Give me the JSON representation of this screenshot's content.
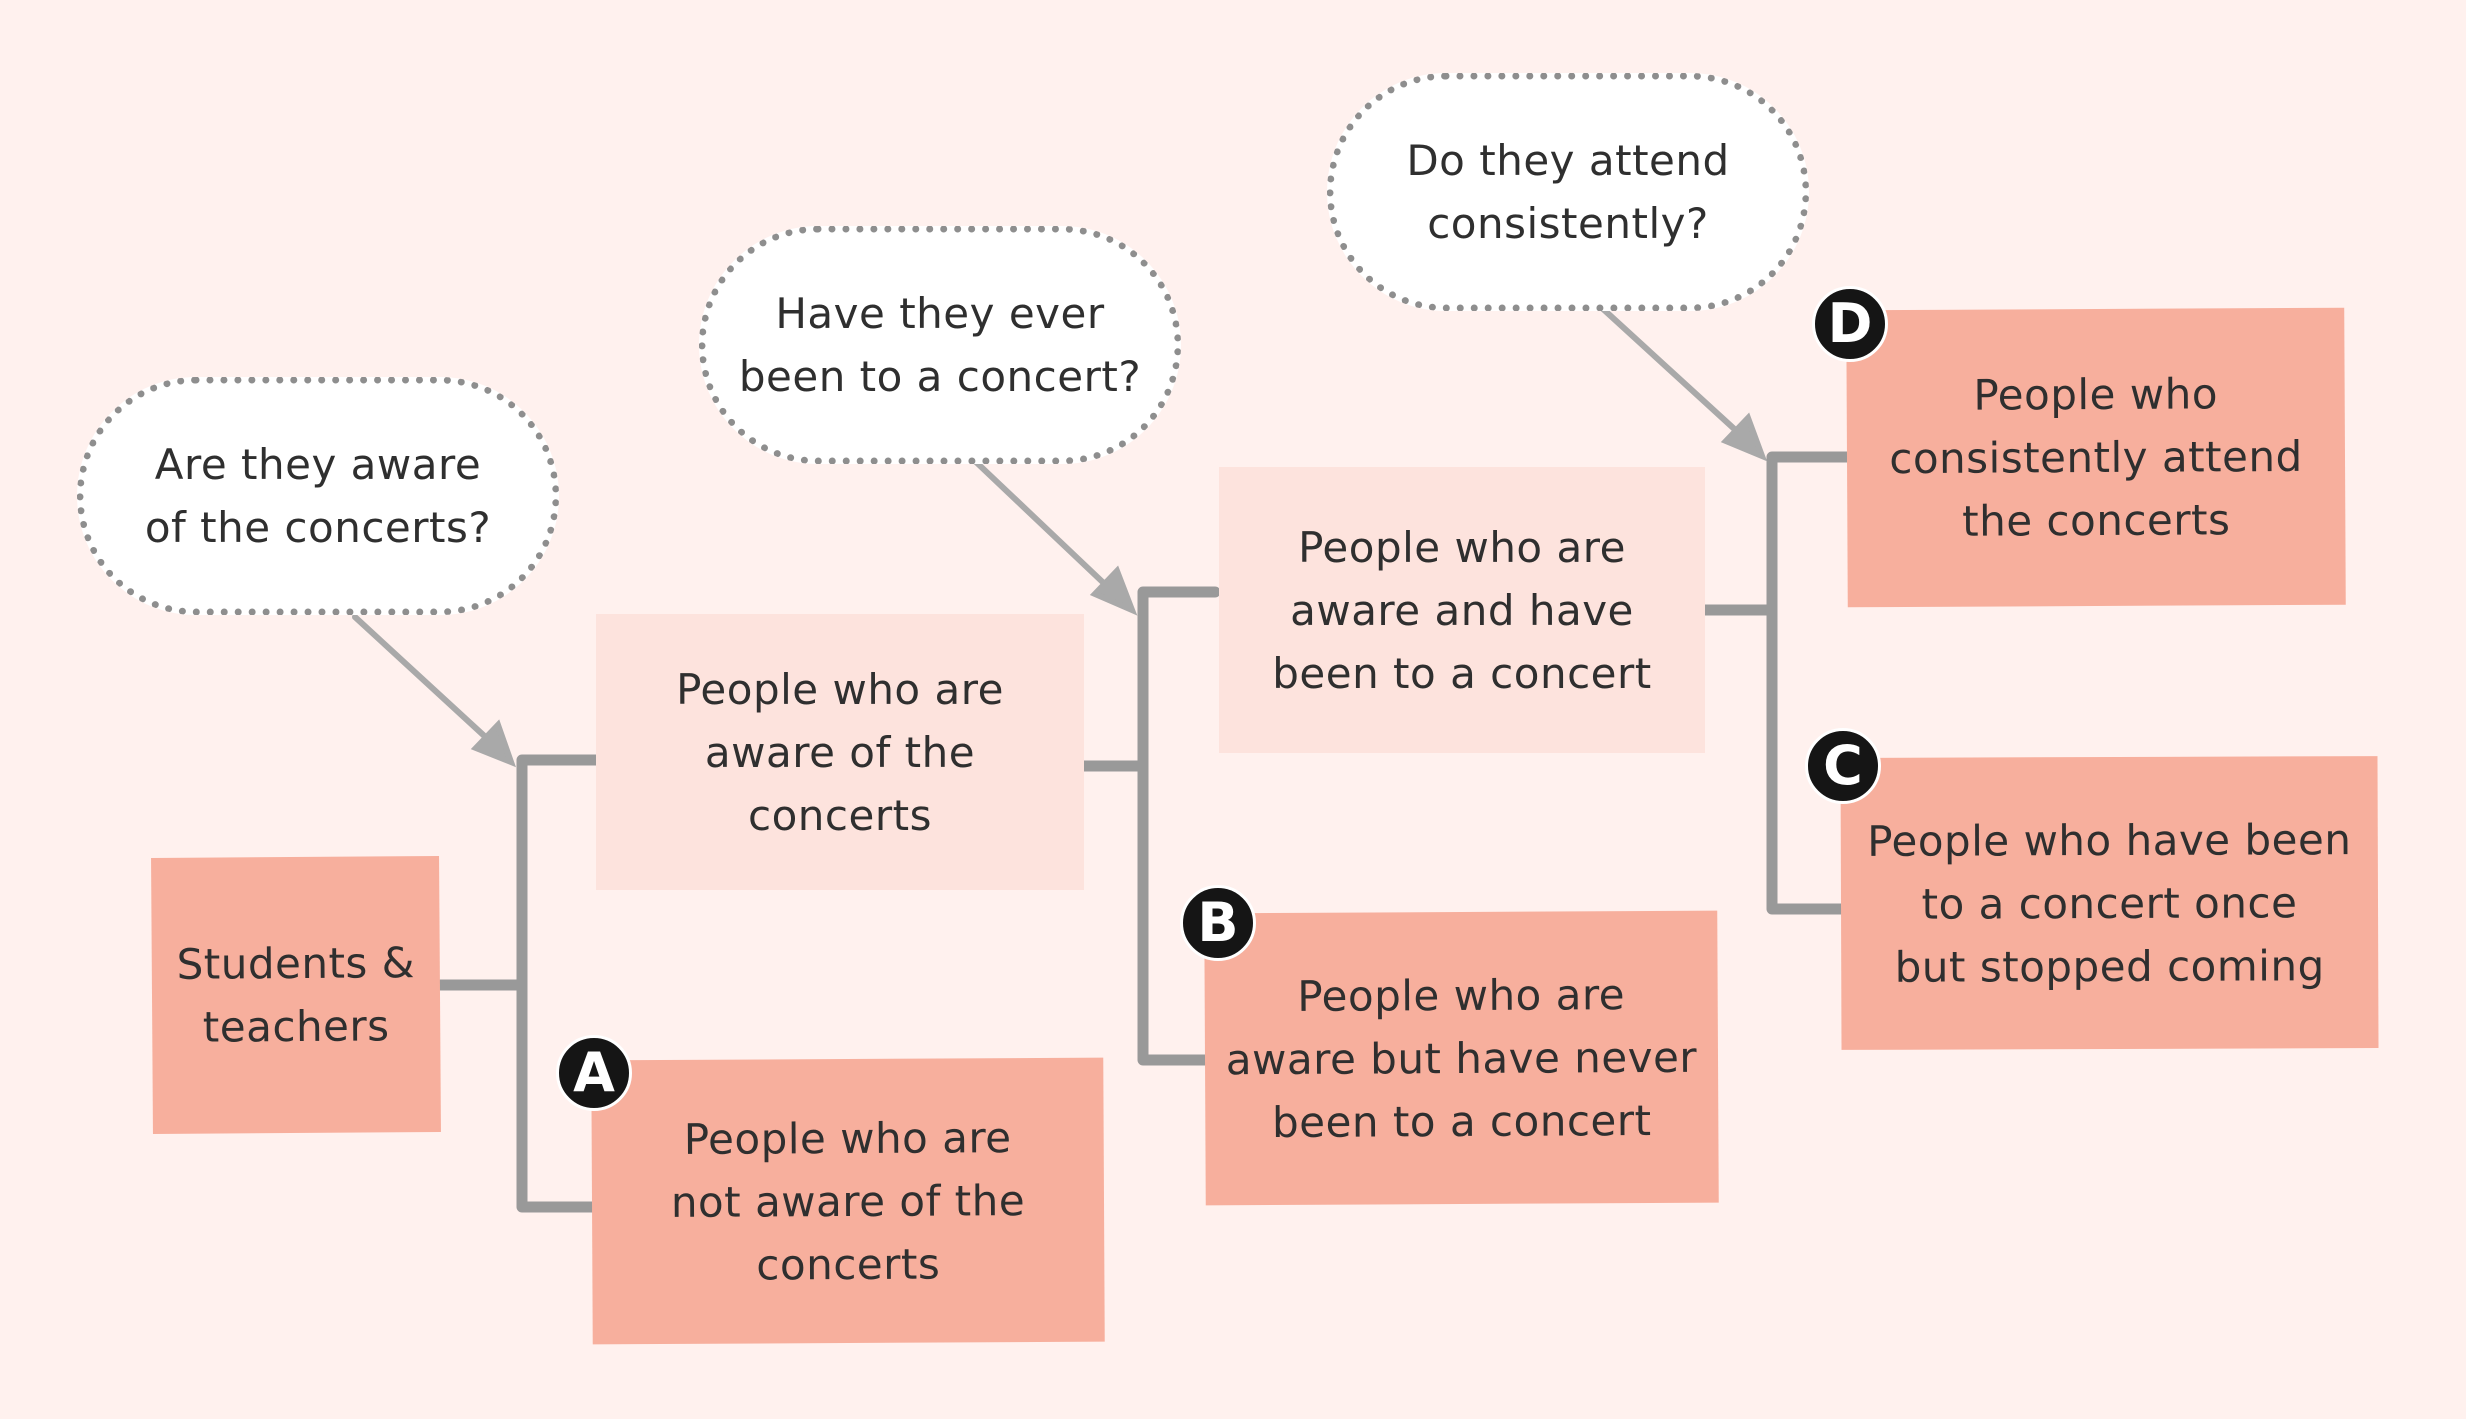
{
  "colors": {
    "background": "#FFF1EE",
    "strong_box": "#F7AF9D",
    "light_box": "#FDE3DD",
    "connector": "#999999",
    "badge": "#151515"
  },
  "questions": {
    "q1": "Are they aware\nof the concerts?",
    "q2": "Have they ever\nbeen to a concert?",
    "q3": "Do they attend\nconsistently?"
  },
  "nodes": {
    "root": "Students &\nteachers",
    "aware": "People who are\naware of the\nconcerts",
    "not_aware": "People who are\nnot aware of the\nconcerts",
    "aware_been": "People who are\naware and have\nbeen to a concert",
    "aware_never": "People who are\naware but have never\nbeen to a concert",
    "consistent": "People who\nconsistently attend\nthe concerts",
    "stopped": "People who have been\nto a concert once\nbut stopped coming"
  },
  "badges": {
    "a": "A",
    "b": "B",
    "c": "C",
    "d": "D"
  }
}
